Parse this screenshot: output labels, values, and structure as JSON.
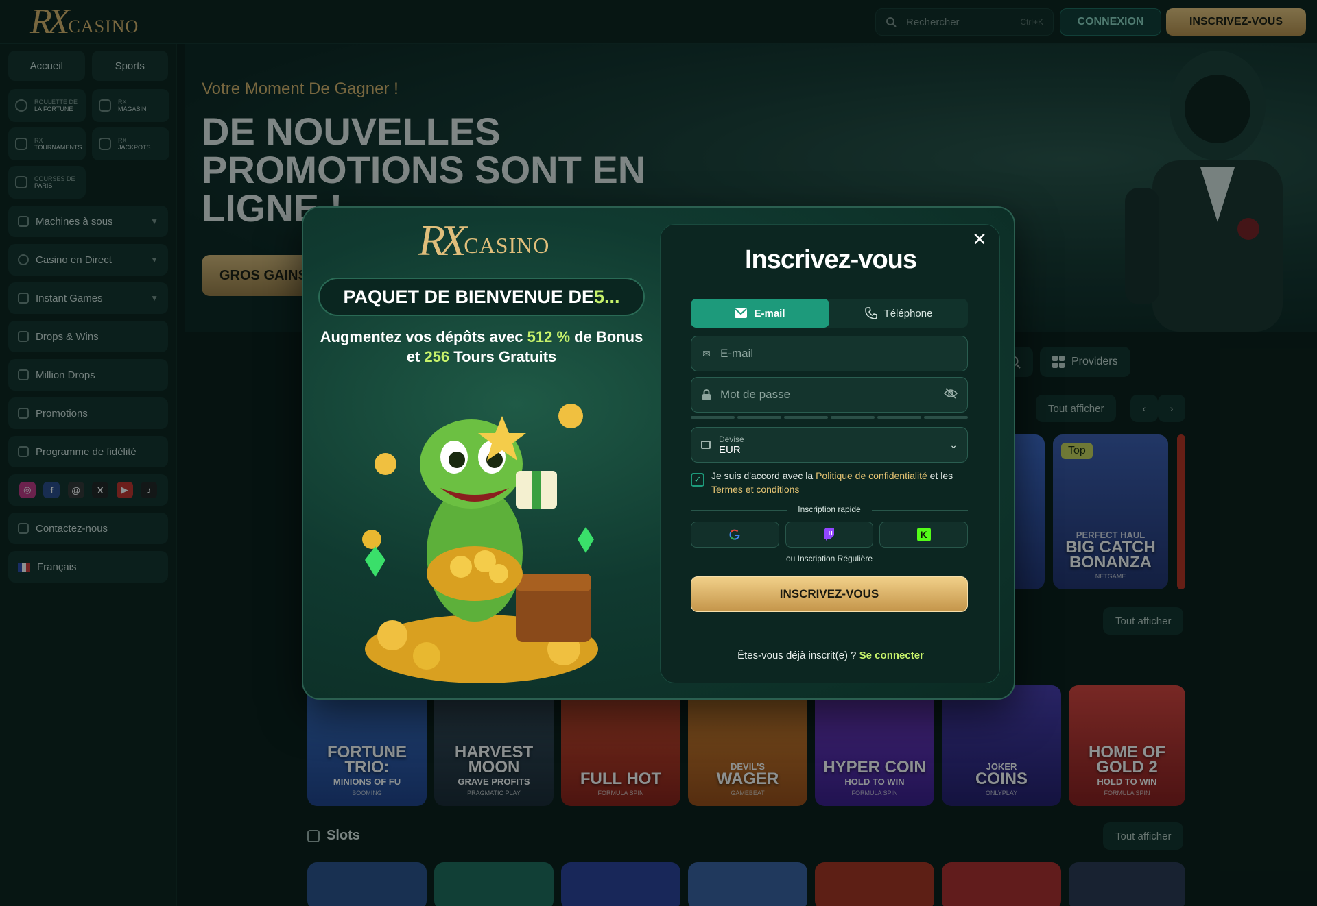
{
  "header": {
    "logo_rx": "RX",
    "logo_text": "CASINO",
    "search_placeholder": "Rechercher",
    "search_shortcut": "Ctrl+K",
    "login_label": "CONNEXION",
    "signup_label": "INSCRIVEZ-VOUS"
  },
  "sidebar": {
    "tabs": [
      "Accueil",
      "Sports"
    ],
    "mini": [
      {
        "top": "Roulette de",
        "bottom": "la fortune"
      },
      {
        "top": "RX",
        "bottom": "Magasin"
      },
      {
        "top": "RX",
        "bottom": "Tournaments"
      },
      {
        "top": "RX",
        "bottom": "Jackpots"
      },
      {
        "top": "Courses de",
        "bottom": "paris"
      }
    ],
    "items": [
      {
        "label": "Machines à sous",
        "expandable": true
      },
      {
        "label": "Casino en Direct",
        "expandable": true
      },
      {
        "label": "Instant Games",
        "expandable": true
      },
      {
        "label": "Drops & Wins",
        "expandable": false
      },
      {
        "label": "Million Drops",
        "expandable": false
      },
      {
        "label": "Promotions",
        "expandable": false
      },
      {
        "label": "Programme de fidélité",
        "expandable": false
      }
    ],
    "socials": [
      "instagram",
      "facebook",
      "threads",
      "x",
      "youtube",
      "tiktok"
    ],
    "contact": "Contactez-nous",
    "language": "Français"
  },
  "hero": {
    "subtitle": "Votre Moment De Gagner !",
    "title": "DE NOUVELLES PROMOTIONS SONT EN LIGNE !",
    "button": "GROS GAINS"
  },
  "controls": {
    "providers": "Providers",
    "show_all": "Tout afficher"
  },
  "cards_row1": [
    {
      "title": "Big Catch Bonanza",
      "kicker": "Perfect Haul",
      "provider": "Netgame",
      "badge": "Top",
      "color": "#2b3f8a"
    }
  ],
  "cards_row2": [
    {
      "title": "Fortune Trio:",
      "sub": "Minions of Fu",
      "provider": "Booming",
      "color": "#2f5db0"
    },
    {
      "title": "Harvest Moon",
      "sub": "Grave Profits",
      "provider": "Pragmatic Play",
      "color": "#26394a"
    },
    {
      "title": "Full Hot",
      "sub": "",
      "provider": "Formula Spin",
      "color": "#b8301f"
    },
    {
      "title": "Wager",
      "kicker": "Devil's",
      "sub": "",
      "provider": "Gamebeat",
      "color": "#c06a1e"
    },
    {
      "title": "Hyper Coin",
      "sub": "Hold to Win",
      "provider": "Formula Spin",
      "color": "#5a2aa8"
    },
    {
      "title": "Coins",
      "kicker": "Joker",
      "sub": "",
      "provider": "Onlyplay",
      "color": "#3a2a8a"
    },
    {
      "title": "Home of Gold 2",
      "sub": "Hold to Win",
      "provider": "Formula Spin",
      "color": "#b32a2a"
    }
  ],
  "slots_title": "Slots",
  "slots_colors": [
    "#2a4f8a",
    "#1e6b5a",
    "#2a3f9a",
    "#3a5fa0",
    "#a8311e",
    "#b02a2a",
    "#2a3550"
  ],
  "modal": {
    "logo_rx": "RX",
    "logo_text": "CASINO",
    "welcome_prefix": "PAQUET DE BIENVENUE DE ",
    "welcome_highlight": "5...",
    "promo_a": "Augmentez vos dépôts avec ",
    "promo_pct": "512 %",
    "promo_b": " de Bonus et ",
    "promo_spins": "256",
    "promo_c": " Tours Gratuits",
    "title": "Inscrivez-vous",
    "tab_email": "E-mail",
    "tab_phone": "Téléphone",
    "email_placeholder": "E-mail",
    "password_placeholder": "Mot de passe",
    "currency_label": "Devise",
    "currency_value": "EUR",
    "terms_a": "Je suis d'accord avec la ",
    "terms_privacy": "Politique de confidentialité",
    "terms_b": " et les ",
    "terms_tc": "Termes et conditions",
    "quick_label": "Inscription rapide",
    "regular_label": "ou Inscription Régulière",
    "submit": "INSCRIVEZ-VOUS",
    "already": "Êtes-vous déjà inscrit(e) ? ",
    "login_link": "Se connecter"
  }
}
